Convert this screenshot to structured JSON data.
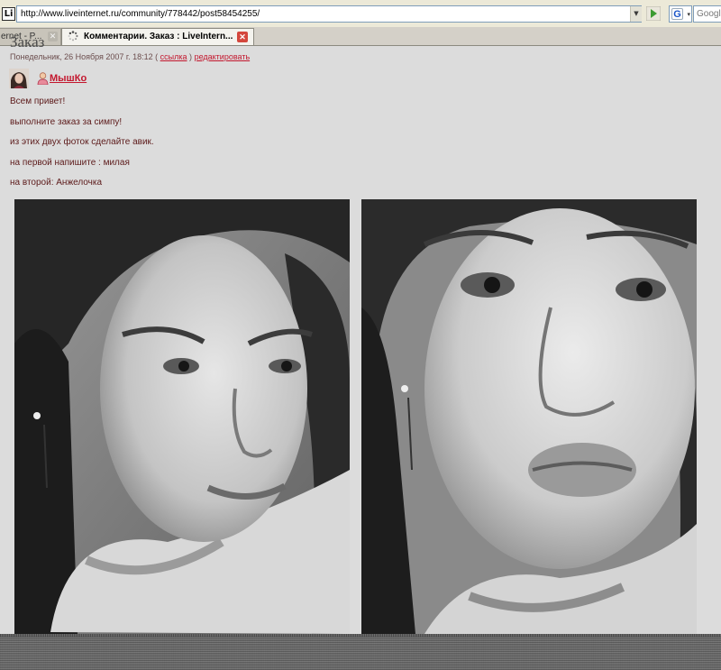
{
  "browser": {
    "site_icon_text": "Li",
    "url": "http://www.liveinternet.ru/community/778442/post58454255/",
    "search_placeholder": "Google",
    "tabs": [
      {
        "label": "ernet - P..."
      },
      {
        "label": "Комментарии. Заказ : LiveIntern..."
      }
    ]
  },
  "post": {
    "title": "Заказ",
    "meta_prefix": "Понедельник, 26 Ноября 2007 г. 18:12 (",
    "meta_link_label": "ссылка",
    "meta_sep": ")",
    "meta_edit_label": "редактировать",
    "author": "МышКо",
    "lines": [
      "Всем привет!",
      "выполните заказ за симпу!",
      "из этих двух фоток сделайте авик.",
      "на первой напишите : милая",
      "на второй: Анжелочка"
    ]
  },
  "colors": {
    "page_bg": "#dcdcdc",
    "link": "#c3172e",
    "text": "#5c1a1a"
  }
}
